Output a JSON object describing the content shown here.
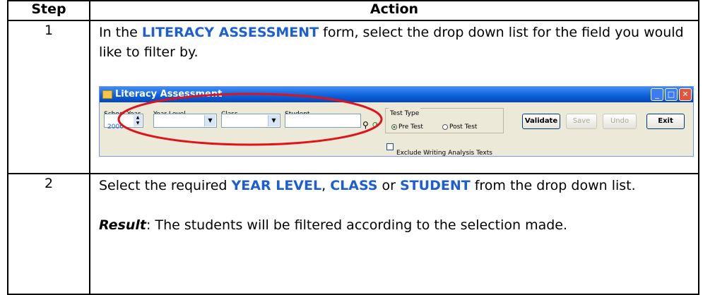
{
  "table": {
    "header_step": "Step",
    "header_action": "Action"
  },
  "rows": [
    {
      "step": "1",
      "text_prefix": "In the ",
      "text_kw": "LITERACY ASSESSMENT",
      "text_suffix": " form, select the drop down list for the field you would like to filter by."
    },
    {
      "step": "2",
      "text_a": "Select the required ",
      "kw1": "YEAR LEVEL",
      "sep1": ", ",
      "kw2": "CLASS",
      "sep2": " or ",
      "kw3": "STUDENT",
      "text_b": " from the drop down list.",
      "result_label": "Result",
      "result_text": ": The students will be filtered according to the selection made."
    }
  ],
  "screenshot": {
    "window_title": "Literacy Assessment",
    "school_year_label": "School Year",
    "school_year_value": "2006",
    "year_level_label": "Year Level",
    "class_label": "Class",
    "student_label": "Student",
    "test_type_label": "Test Type",
    "pre_test_label": "Pre Test",
    "post_test_label": "Post Test",
    "validate_label": "Validate",
    "save_label": "Save",
    "undo_label": "Undo",
    "exit_label": "Exit",
    "exclude_label": "Exclude Writing Analysis Texts",
    "highlight_color": "#e0121b",
    "keyword_color": "#1d5fd2"
  }
}
